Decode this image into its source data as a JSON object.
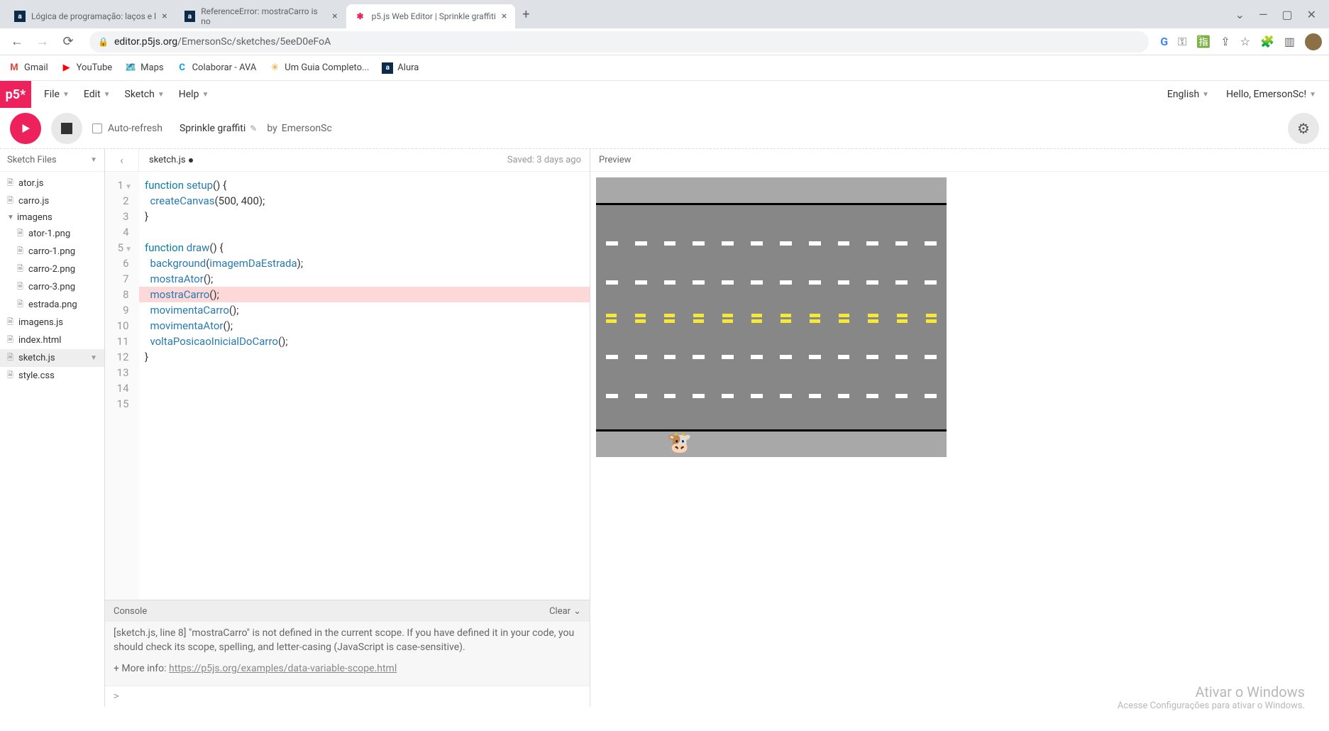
{
  "browser": {
    "tabs": [
      {
        "favicon": "a",
        "favicon_bg": "#0b2b4a",
        "favicon_color": "#fff",
        "title": "Lógica de programação: laços e l"
      },
      {
        "favicon": "a",
        "favicon_bg": "#0b2b4a",
        "favicon_color": "#fff",
        "title": "ReferenceError: mostraCarro is no"
      },
      {
        "favicon": "✱",
        "favicon_bg": "transparent",
        "favicon_color": "#ed225d",
        "title": "p5.js Web Editor | Sprinkle graffiti",
        "active": true
      }
    ],
    "url_domain": "editor.p5js.org",
    "url_path": "/EmersonSc/sketches/5eeD0eFoA",
    "window_controls": {
      "min": "—",
      "max": "▢",
      "close": "✕"
    },
    "chevron": "⌄"
  },
  "bookmarks": [
    {
      "icon": "M",
      "color": "#ea4335",
      "label": "Gmail"
    },
    {
      "icon": "▶",
      "color": "#ff0000",
      "label": "YouTube"
    },
    {
      "icon": "◆",
      "color": "#34a853",
      "label": "Maps"
    },
    {
      "icon": "C",
      "color": "#00a3e0",
      "label": "Colaborar - AVA"
    },
    {
      "icon": "✳",
      "color": "#f29900",
      "label": "Um Guia Completo..."
    },
    {
      "icon": "a",
      "color": "#0b2b4a",
      "label": "Alura"
    }
  ],
  "p5": {
    "logo": "p5*",
    "menus": [
      "File",
      "Edit",
      "Sketch",
      "Help"
    ],
    "language": "English",
    "greeting": "Hello, EmersonSc!"
  },
  "toolbar": {
    "auto_refresh": "Auto-refresh",
    "sketch_name": "Sprinkle graffiti",
    "by": "by",
    "author": "EmersonSc"
  },
  "sidebar": {
    "header": "Sketch Files",
    "files": [
      {
        "name": "ator.js",
        "type": "file",
        "level": 0
      },
      {
        "name": "carro.js",
        "type": "file",
        "level": 0
      },
      {
        "name": "imagens",
        "type": "folder",
        "level": 0,
        "open": true
      },
      {
        "name": "ator-1.png",
        "type": "file",
        "level": 1
      },
      {
        "name": "carro-1.png",
        "type": "file",
        "level": 1
      },
      {
        "name": "carro-2.png",
        "type": "file",
        "level": 1
      },
      {
        "name": "carro-3.png",
        "type": "file",
        "level": 1
      },
      {
        "name": "estrada.png",
        "type": "file",
        "level": 1
      },
      {
        "name": "imagens.js",
        "type": "file",
        "level": 0
      },
      {
        "name": "index.html",
        "type": "file",
        "level": 0
      },
      {
        "name": "sketch.js",
        "type": "file",
        "level": 0,
        "selected": true
      },
      {
        "name": "style.css",
        "type": "file",
        "level": 0
      }
    ]
  },
  "editor": {
    "collapse": "‹",
    "current_file": "sketch.js",
    "saved": "Saved: 3 days ago",
    "lines": 15,
    "code": {
      "l1_a": "function ",
      "l1_b": "setup",
      "l1_c": "() {",
      "l2_a": "  ",
      "l2_b": "createCanvas",
      "l2_c": "(500, 400);",
      "l3": "}",
      "l4": "",
      "l5_a": "function ",
      "l5_b": "draw",
      "l5_c": "() {",
      "l6_a": "  ",
      "l6_b": "background",
      "l6_c": "(",
      "l6_d": "imagemDaEstrada",
      "l6_e": ");",
      "l7_a": "  ",
      "l7_b": "mostraAtor",
      "l7_c": "();",
      "l8_a": "  ",
      "l8_b": "mostraCarro",
      "l8_c": "();",
      "l9_a": "  ",
      "l9_b": "movimentaCarro",
      "l9_c": "();",
      "l10_a": "  ",
      "l10_b": "movimentaAtor",
      "l10_c": "();",
      "l11_a": "  ",
      "l11_b": "voltaPosicaoInicialDoCarro",
      "l11_c": "();",
      "l12": "}"
    }
  },
  "console": {
    "header": "Console",
    "clear": "Clear",
    "msg1": "[sketch.js, line 8] \"mostraCarro\" is not defined in the current scope. If you have defined it in your code, you should check its scope, spelling, and letter-casing (JavaScript is case-sensitive).",
    "msg2": "+ More info: ",
    "link": "https://p5js.org/examples/data-variable-scope.html",
    "prompt": ">"
  },
  "preview": {
    "header": "Preview"
  },
  "watermark": {
    "title": "Ativar o Windows",
    "sub": "Acesse Configurações para ativar o Windows."
  }
}
